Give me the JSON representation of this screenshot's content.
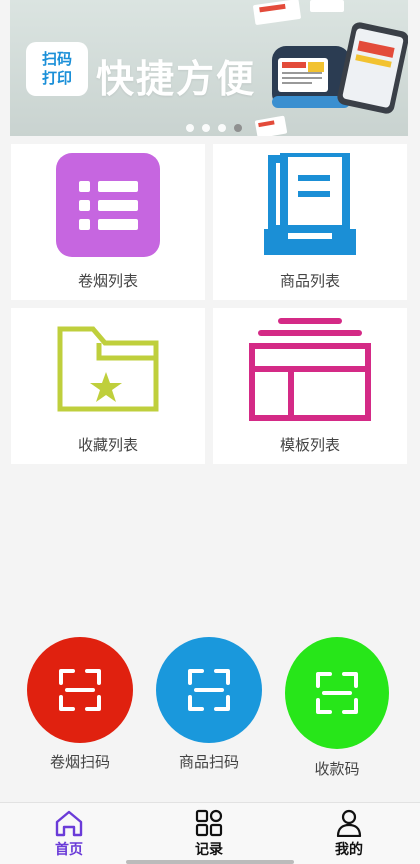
{
  "banner": {
    "badge_line1": "扫码",
    "badge_line2": "打印",
    "title": "快捷方便",
    "dots": 4,
    "active_dot": 4
  },
  "grid": [
    {
      "label": "卷烟列表",
      "icon": "list-icon",
      "color": "#c666e0"
    },
    {
      "label": "商品列表",
      "icon": "document-tray-icon",
      "color": "#1b8fd6"
    },
    {
      "label": "收藏列表",
      "icon": "star-folder-icon",
      "color": "#bfcf3c"
    },
    {
      "label": "模板列表",
      "icon": "template-layout-icon",
      "color": "#d42a86"
    }
  ],
  "scans": [
    {
      "label": "卷烟扫码",
      "color": "#e0210f"
    },
    {
      "label": "商品扫码",
      "color": "#1a98dc"
    },
    {
      "label": "收款码",
      "color": "#27e619"
    }
  ],
  "nav": {
    "home": "首页",
    "records": "记录",
    "mine": "我的",
    "active": "首页",
    "active_color": "#6a3bd8"
  }
}
